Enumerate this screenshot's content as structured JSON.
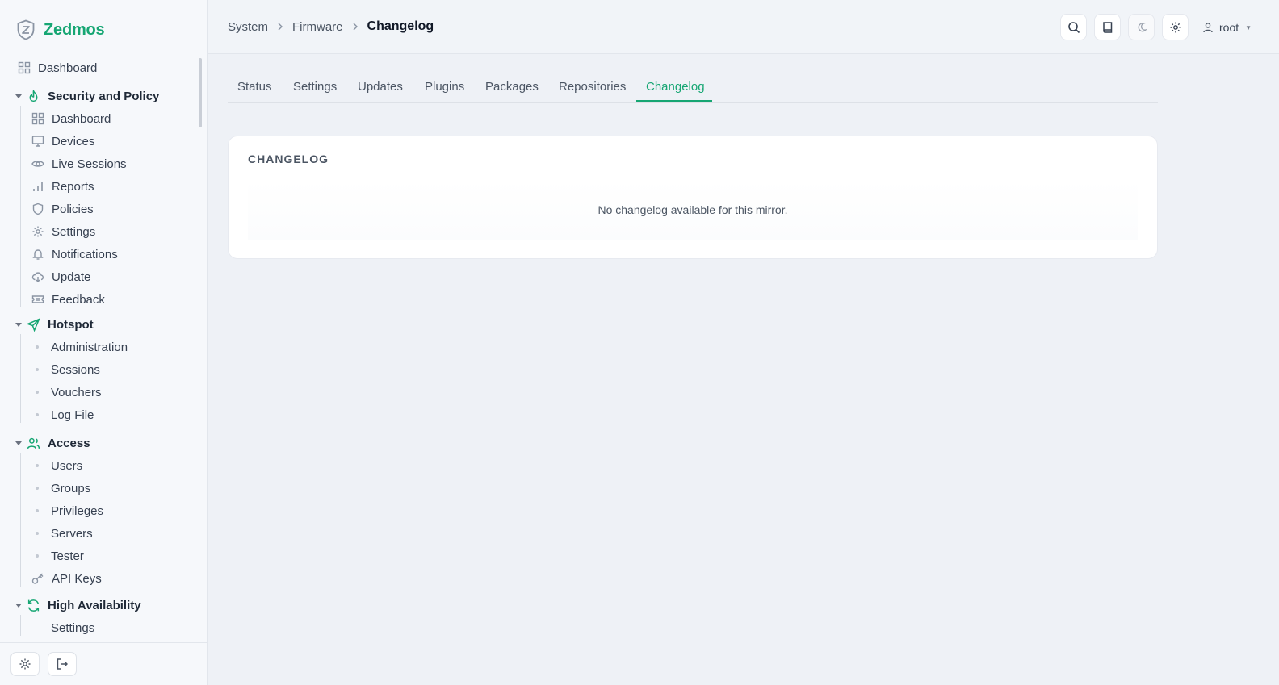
{
  "brand": {
    "name": "Zedmos",
    "accent": "#16a673"
  },
  "sidebar": {
    "top_item": {
      "label": "Dashboard",
      "icon": "dashboard-icon"
    },
    "sections": [
      {
        "title": "Security and Policy",
        "icon": "flame-icon",
        "items": [
          {
            "label": "Dashboard",
            "icon": "dashboard-icon"
          },
          {
            "label": "Devices",
            "icon": "monitor-icon"
          },
          {
            "label": "Live Sessions",
            "icon": "eye-icon"
          },
          {
            "label": "Reports",
            "icon": "bar-chart-icon"
          },
          {
            "label": "Policies",
            "icon": "shield-icon"
          },
          {
            "label": "Settings",
            "icon": "gear-icon"
          },
          {
            "label": "Notifications",
            "icon": "bell-icon"
          },
          {
            "label": "Update",
            "icon": "cloud-download-icon"
          },
          {
            "label": "Feedback",
            "icon": "ticket-icon"
          }
        ]
      },
      {
        "title": "Hotspot",
        "icon": "send-icon",
        "items": [
          {
            "label": "Administration"
          },
          {
            "label": "Sessions"
          },
          {
            "label": "Vouchers"
          },
          {
            "label": "Log File"
          }
        ]
      },
      {
        "title": "Access",
        "icon": "users-icon",
        "items": [
          {
            "label": "Users"
          },
          {
            "label": "Groups"
          },
          {
            "label": "Privileges"
          },
          {
            "label": "Servers"
          },
          {
            "label": "Tester"
          },
          {
            "label": "API Keys",
            "icon": "key-icon"
          }
        ]
      },
      {
        "title": "High Availability",
        "icon": "refresh-icon",
        "items": [
          {
            "label": "Settings"
          }
        ]
      }
    ]
  },
  "header": {
    "breadcrumb": [
      "System",
      "Firmware",
      "Changelog"
    ],
    "user": "root"
  },
  "tabs": [
    "Status",
    "Settings",
    "Updates",
    "Plugins",
    "Packages",
    "Repositories",
    "Changelog"
  ],
  "active_tab": "Changelog",
  "card": {
    "title": "CHANGELOG",
    "empty_message": "No changelog available for this mirror."
  }
}
